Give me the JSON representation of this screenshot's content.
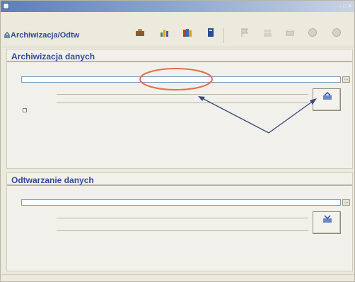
{
  "window": {
    "title": "",
    "controls": "- □ ×"
  },
  "menu": {
    "items": []
  },
  "toolbar": {
    "title": "Archiwizacja/Odtw",
    "buttons": [],
    "disabled_buttons": []
  },
  "archive": {
    "header": "Archiwizacja danych",
    "path_caption": "",
    "path_value": "",
    "browse_label": "...",
    "row1_label": "",
    "row2_label": "",
    "checkbox_label": "",
    "action_label": ""
  },
  "restore": {
    "header": "Odtwarzanie danych",
    "path_caption": "",
    "path_value": "",
    "browse_label": "...",
    "row1_label": "",
    "row2_label": "",
    "action_label": ""
  },
  "icons": {
    "app": "app-icon",
    "title": "archive-title-icon",
    "archive_action": "archive-icon",
    "restore_action": "restore-icon",
    "browse": "folder-browse-icon"
  },
  "colors": {
    "accent": "#33499b",
    "highlight": "#e07050",
    "titlebar": "#5c7fb8",
    "arrow": "#3a4a7a"
  }
}
